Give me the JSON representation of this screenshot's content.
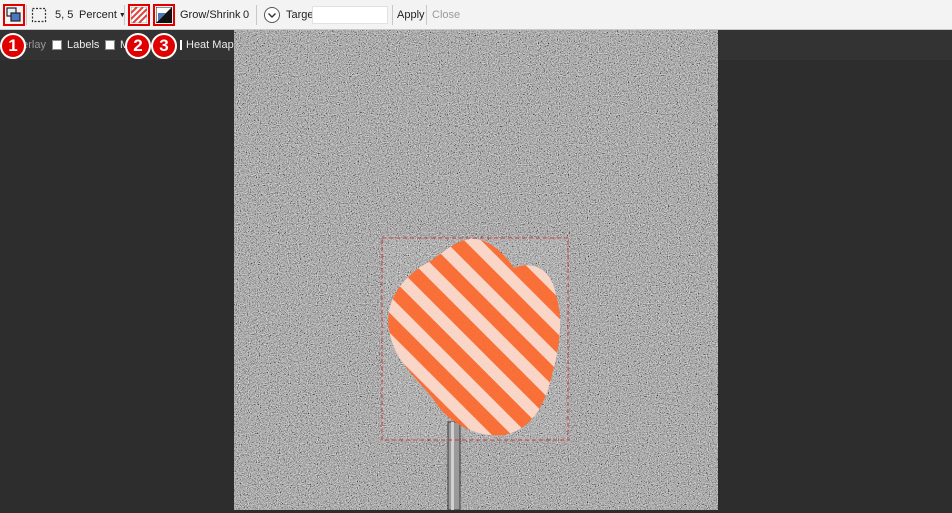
{
  "toolbar": {
    "tools": [
      {
        "name": "region-tool",
        "icon": "region-tool-icon"
      },
      {
        "name": "selection",
        "icon": "dashed-selection-icon"
      },
      {
        "name": "hatch",
        "icon": "hatch-fill-icon"
      },
      {
        "name": "contrast",
        "icon": "contrast-toggle-icon"
      }
    ],
    "size_value": "5, 5",
    "unit_label": "Percent",
    "grow_shrink_label": "Grow/Shrink",
    "grow_shrink_value": "0",
    "target_label": "Target :",
    "target_value": "",
    "apply_label": "Apply",
    "close_label": "Close"
  },
  "viewer": {
    "overlay_label": "Overlay",
    "labels_label": "Labels",
    "m_label": "M",
    "heatmap_label": "Heat Map"
  },
  "callouts": [
    "1",
    "2",
    "3"
  ],
  "colors": {
    "highlight": "#e00000",
    "hatch": "#ff6a2e",
    "toolbar_bg": "#f3f3f3",
    "viewer_bg": "#2d2d2d"
  }
}
